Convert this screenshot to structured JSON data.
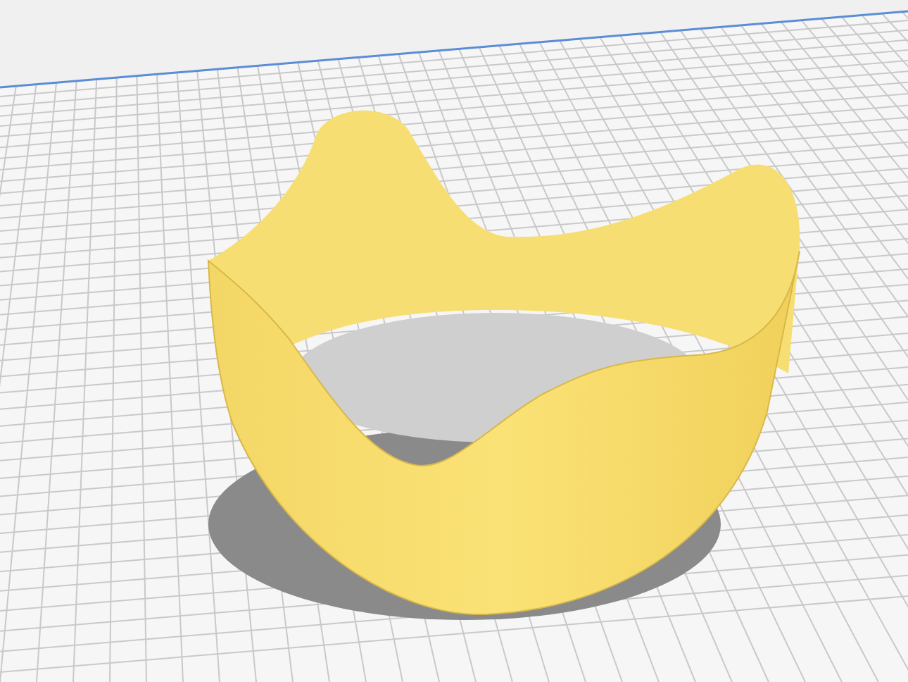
{
  "viewport": {
    "kind": "build-plate-render"
  }
}
